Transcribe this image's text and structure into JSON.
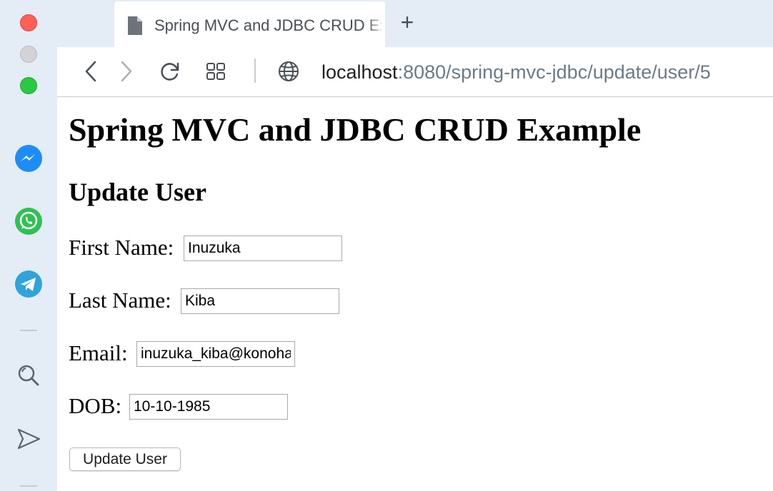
{
  "window": {
    "sidebar_apps": [
      "messenger-icon",
      "whatsapp-icon",
      "telegram-icon",
      "search-icon",
      "send-icon"
    ]
  },
  "tab": {
    "title": "Spring MVC and JDBC CRUD Example"
  },
  "address_bar": {
    "host": "localhost",
    "rest": ":8080/spring-mvc-jdbc/update/user/5"
  },
  "page": {
    "heading": "Spring MVC and JDBC CRUD Example",
    "subheading": "Update User",
    "form": {
      "first_name_label": "First Name:",
      "first_name_value": "Inuzuka",
      "last_name_label": "Last Name:",
      "last_name_value": "Kiba",
      "email_label": "Email:",
      "email_value": "inuzuka_kiba@konoha",
      "dob_label": "DOB:",
      "dob_value": "10-10-1985",
      "submit_label": "Update User"
    }
  },
  "colors": {
    "chrome_bg": "#e4ecf5",
    "close": "#fe5f57",
    "minimize": "#d3d3d3",
    "maximize": "#2ac940",
    "messenger": "#1e8cf7",
    "whatsapp": "#2fc152",
    "telegram": "#2fa3db"
  }
}
